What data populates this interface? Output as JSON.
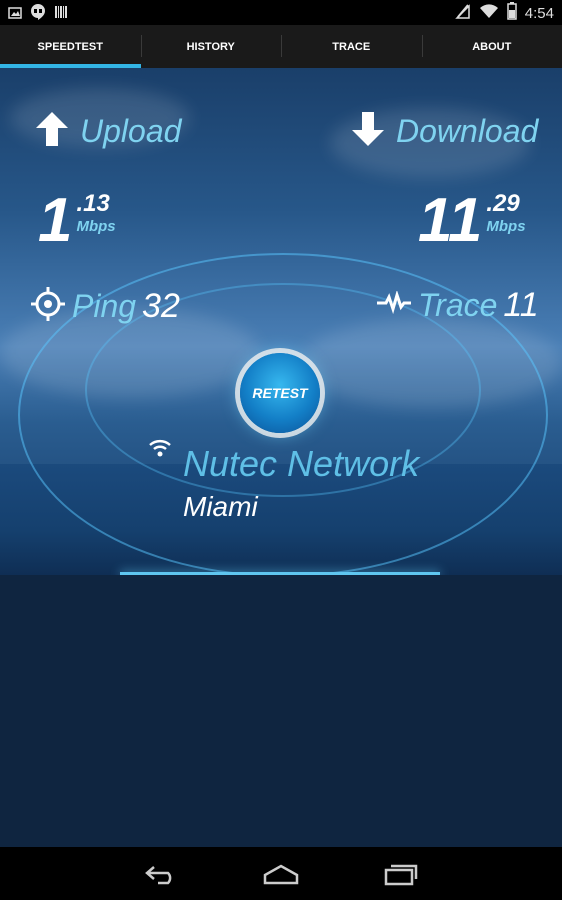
{
  "status_bar": {
    "time": "4:54",
    "icons": [
      "image-icon",
      "hangouts-icon",
      "barcode-icon",
      "signal-off-icon",
      "wifi-icon",
      "battery-icon"
    ]
  },
  "tabs": [
    {
      "label": "SPEEDTEST",
      "active": true
    },
    {
      "label": "HISTORY",
      "active": false
    },
    {
      "label": "TRACE",
      "active": false
    },
    {
      "label": "ABOUT",
      "active": false
    }
  ],
  "upload": {
    "label": "Upload",
    "int": "1",
    "dec": ".13",
    "unit": "Mbps",
    "icon": "arrow-up-icon"
  },
  "download": {
    "label": "Download",
    "int": "11",
    "dec": ".29",
    "unit": "Mbps",
    "icon": "arrow-down-icon"
  },
  "ping": {
    "label": "Ping",
    "value": "32",
    "icon": "crosshair-icon"
  },
  "trace": {
    "label": "Trace",
    "value": "11",
    "icon": "waveform-icon"
  },
  "retest": {
    "label": "RETEST"
  },
  "network": {
    "name": "Nutec Network",
    "city": "Miami",
    "icon": "wifi-icon"
  },
  "navbar": {
    "buttons": [
      "back-icon",
      "home-icon",
      "recents-icon"
    ]
  },
  "colors": {
    "accent": "#33b5e5",
    "label": "#7fd3f0",
    "network": "#5fbfe6",
    "bg": "#0f2540"
  }
}
